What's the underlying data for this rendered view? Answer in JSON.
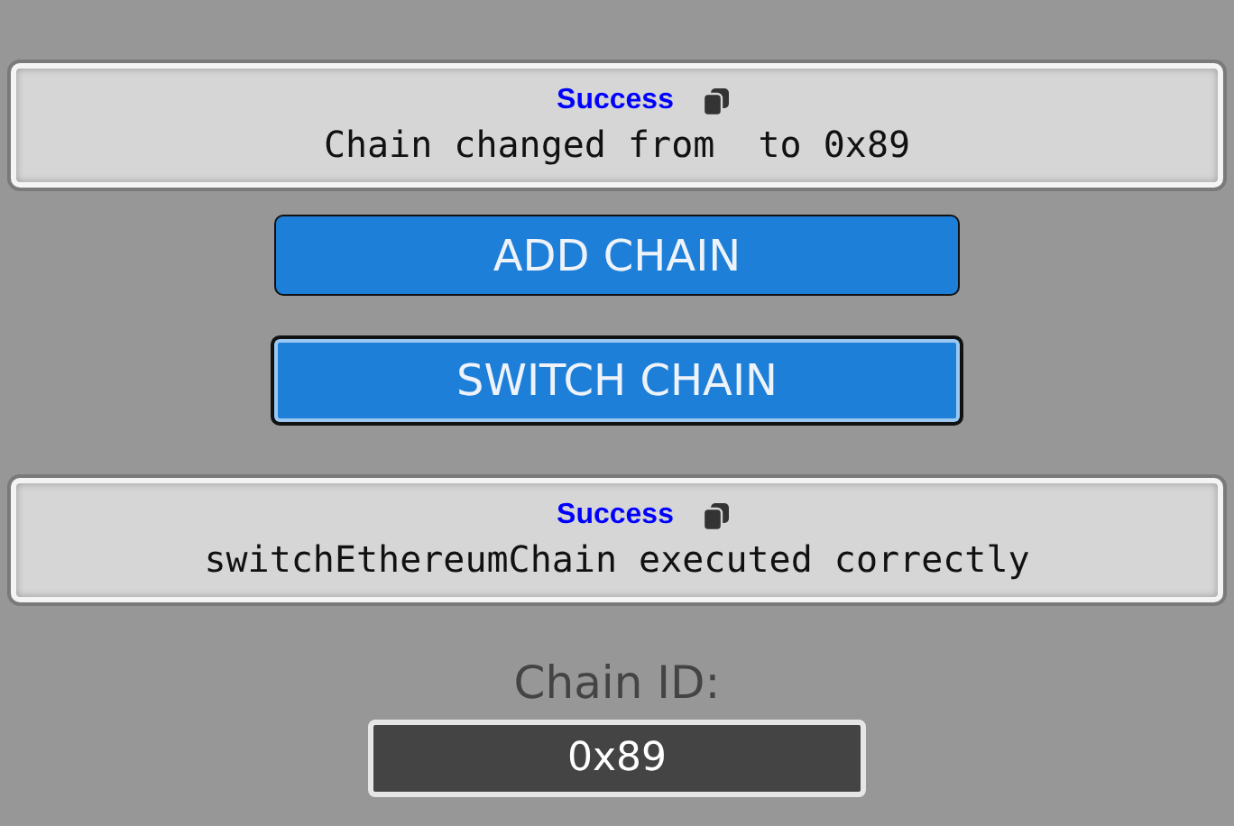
{
  "alerts_top": [
    {
      "title": "Success",
      "message": "Chain changed from  to 0x89"
    }
  ],
  "buttons": [
    {
      "label": "ADD CHAIN",
      "focused": false
    },
    {
      "label": "SWITCH CHAIN",
      "focused": true
    }
  ],
  "alerts_bottom": [
    {
      "title": "Success",
      "message": "switchEthereumChain executed correctly"
    }
  ],
  "chain_id": {
    "label": "Chain ID:",
    "value": "0x89"
  }
}
